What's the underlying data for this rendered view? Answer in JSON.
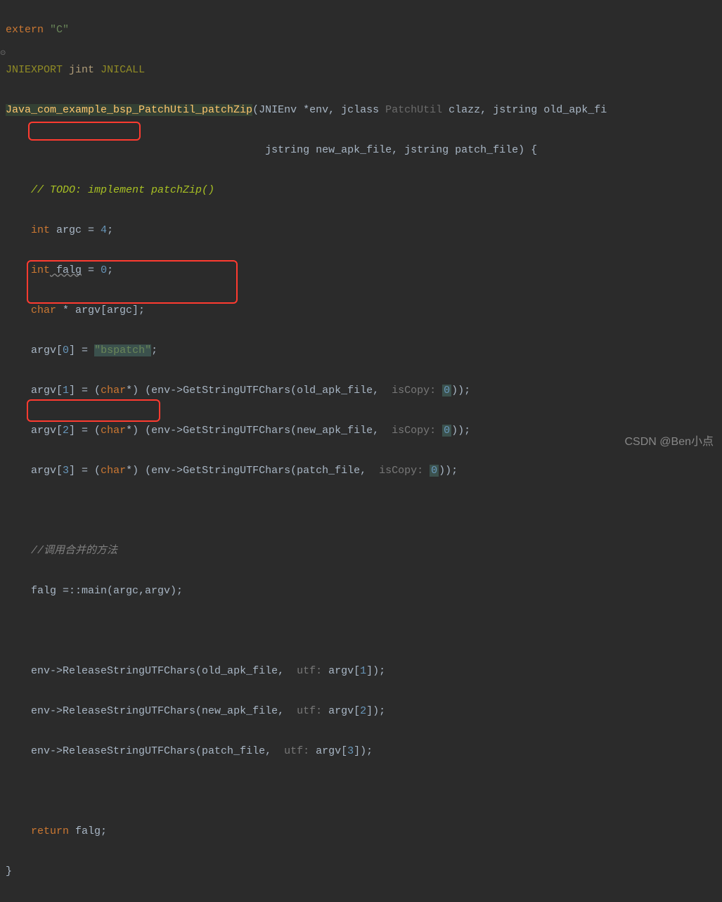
{
  "code": {
    "l1_extern": "extern",
    "l1_c": "\"C\"",
    "l2_macro1": "JNIEXPORT",
    "l2_type": "jint",
    "l2_macro2": "JNICALL",
    "l3_func": "Java_com_example_bsp_PatchUtil_patchZip",
    "l3_p1": "(JNIEnv *env",
    "l3_comma1": ", ",
    "l3_p2t": "jclass",
    "l3_p2hint": "PatchUtil",
    "l3_p2n": " clazz",
    "l3_comma2": ", ",
    "l3_p3": "jstring old_apk_fi",
    "l4_p4": "jstring new_apk_file",
    "l4_comma": ", ",
    "l4_p5": "jstring patch_file) {",
    "l5_todo": "// TODO: implement patchZip()",
    "l6_int": "int",
    "l6_rest": " argc = ",
    "l6_num": "4",
    "l6_semi": ";",
    "l7_int": "int",
    "l7_var": " falg",
    "l7_eq": " = ",
    "l7_num": "0",
    "l7_semi": ";",
    "l8_char": "char",
    "l8_rest": " * argv[argc];",
    "l9_a": "argv[",
    "l9_n": "0",
    "l9_eq": "] = ",
    "l9_str": "\"bspatch\"",
    "l9_semi": ";",
    "l10_a": "argv[",
    "l10_n": "1",
    "l10_eq": "] = (",
    "l10_cast": "char",
    "l10_rest": "*) (env->GetStringUTFChars(old_apk_file, ",
    "l10_hint": " isCopy: ",
    "l10_z": "0",
    "l10_end": "));",
    "l11_a": "argv[",
    "l11_n": "2",
    "l11_eq": "] = (",
    "l11_cast": "char",
    "l11_rest": "*) (env->GetStringUTFChars(new_apk_file, ",
    "l11_hint": " isCopy: ",
    "l11_z": "0",
    "l11_end": "));",
    "l12_a": "argv[",
    "l12_n": "3",
    "l12_eq": "] = (",
    "l12_cast": "char",
    "l12_rest": "*) (env->GetStringUTFChars(patch_file, ",
    "l12_hint": " isCopy: ",
    "l12_z": "0",
    "l12_end": "));",
    "l14_comment": "//调用合并的方法",
    "l15": "falg =::main(argc,argv);",
    "l17_a": "env->ReleaseStringUTFChars(old_apk_file, ",
    "l17_hint": " utf: ",
    "l17_b": "argv[",
    "l17_n": "1",
    "l17_end": "]);",
    "l18_a": "env->ReleaseStringUTFChars(new_apk_file, ",
    "l18_hint": " utf: ",
    "l18_b": "argv[",
    "l18_n": "2",
    "l18_end": "]);",
    "l19_a": "env->ReleaseStringUTFChars(patch_file, ",
    "l19_hint": " utf: ",
    "l19_b": "argv[",
    "l19_n": "3",
    "l19_end": "]);",
    "l21_ret": "return",
    "l21_val": " falg;",
    "l22": "}"
  },
  "watermark": "CSDN @Ben小点"
}
